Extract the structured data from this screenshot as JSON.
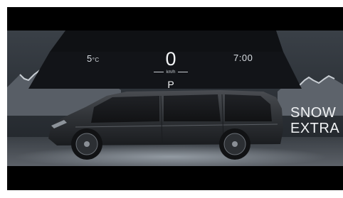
{
  "hud": {
    "temperature_value": "5",
    "temperature_unit": "°C",
    "speed": "0",
    "speed_unit": "km/h",
    "gear": "P",
    "time": "7:00"
  },
  "mode": {
    "line1": "SNOW",
    "line2": "EXTRA"
  },
  "colors": {
    "background": "#000000",
    "sky": "#2a2f35",
    "center_panel": "#0e1013",
    "text": "#d8dde2"
  },
  "icons": [
    "vehicle-minivan-graphic",
    "mountain-range-graphic"
  ]
}
